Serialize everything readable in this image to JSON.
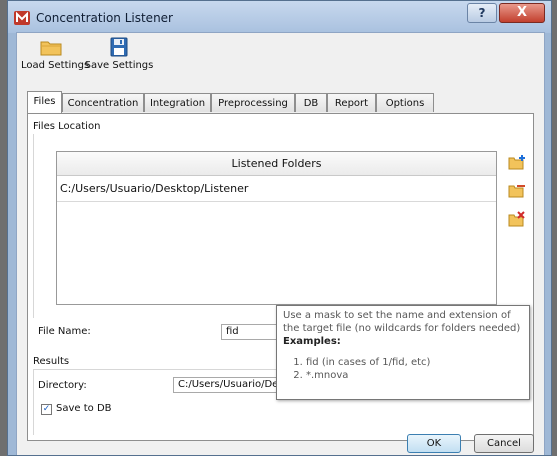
{
  "window": {
    "title": "Concentration Listener",
    "help": "?",
    "close": "X"
  },
  "toolbar": {
    "load_label": "Load Settings",
    "load_icon": "folder-icon",
    "save_label": "Save Settings",
    "save_icon": "floppy-disk-icon"
  },
  "tabs": [
    {
      "label": "Files",
      "active": true
    },
    {
      "label": "Concentration"
    },
    {
      "label": "Integration"
    },
    {
      "label": "Preprocessing"
    },
    {
      "label": "DB"
    },
    {
      "label": "Report"
    },
    {
      "label": "Options"
    }
  ],
  "files_location": {
    "title": "Files Location",
    "table_header": "Listened Folders",
    "rows": [
      "C:/Users/Usuario/Desktop/Listener"
    ],
    "icons": [
      "add-folder-icon",
      "edit-folder-icon",
      "remove-folder-icon"
    ]
  },
  "file_name": {
    "label": "File Name:",
    "value": "fid"
  },
  "results": {
    "title": "Results",
    "directory_label": "Directory:",
    "directory_value": "C:/Users/Usuario/Desktop/",
    "save_to_db_label": "Save to DB",
    "save_to_db_checked": true
  },
  "tooltip": {
    "text": "Use a mask to set the name and extension of the target file (no wildcards for folders needed)",
    "examples_label": "Examples:",
    "examples": [
      "fid (in cases of 1/fid, etc)",
      "*.mnova"
    ]
  },
  "buttons": {
    "ok": "OK",
    "cancel": "Cancel"
  },
  "colors": {
    "title_bar": "#a9c1df",
    "close_button": "#c2402e",
    "ok_button_border": "#3c7fb1"
  }
}
